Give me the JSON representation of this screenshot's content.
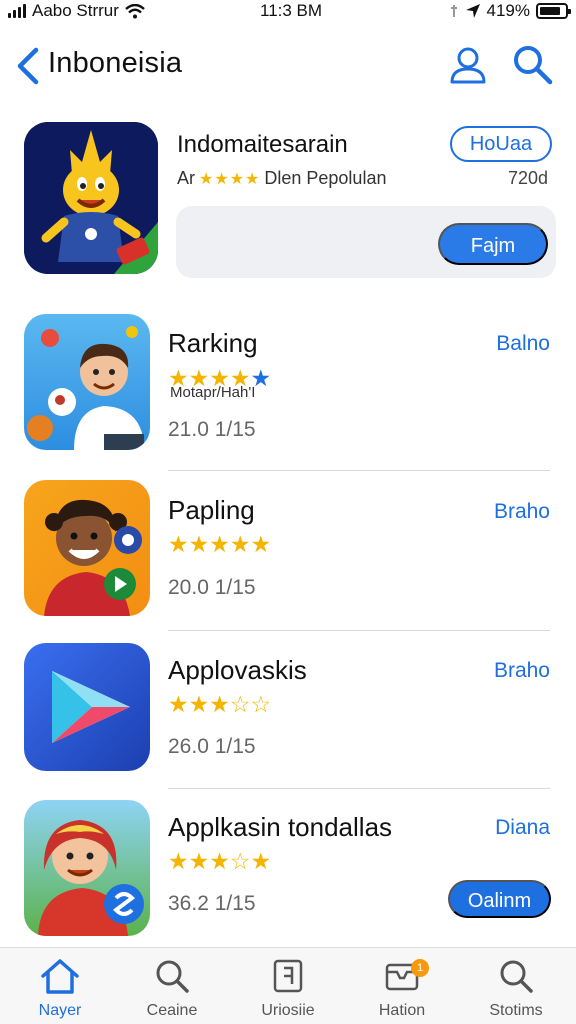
{
  "status_bar": {
    "carrier": "Aabo Strrur",
    "time": "11:3 BM",
    "battery": "419%"
  },
  "nav": {
    "title": "Inboneisia",
    "back_icon": "chevron-left-icon",
    "user_icon": "person-icon",
    "search_icon": "search-icon"
  },
  "featured": {
    "name": "Indomaitesarain",
    "sub_prefix": "Ar",
    "stars": "★★★★",
    "developer": "Dlen Pepolulan",
    "size": "720d",
    "get_label": "HoUaa",
    "panel_button": "Fajm"
  },
  "apps": [
    {
      "name": "Rarking",
      "stars": "★★★★",
      "extra_star": "★",
      "developer": "Motapr/Hah'I",
      "meta": "21.0  1/15",
      "action": "Balno"
    },
    {
      "name": "Papling",
      "stars": "★★★★★",
      "meta": "20.0  1/15",
      "action": "Braho"
    },
    {
      "name": "Applovaskis",
      "stars": "★★★",
      "empty_stars": "☆☆",
      "meta": "26.0  1/15",
      "action": "Braho"
    },
    {
      "name": "Applkasin tondallas",
      "stars": "★★★",
      "half_star": "☆",
      "last_star": "★",
      "meta": "36.2  1/15",
      "action": "Diana",
      "button": "Oalinm"
    }
  ],
  "tabs": [
    {
      "label": "Nayer",
      "icon": "home-icon",
      "active": true
    },
    {
      "label": "Ceaine",
      "icon": "search-icon"
    },
    {
      "label": "Uriosiie",
      "icon": "document-icon"
    },
    {
      "label": "Hation",
      "icon": "inbox-icon",
      "badge": "1"
    },
    {
      "label": "Stotims",
      "icon": "search-icon"
    }
  ],
  "colors": {
    "accent": "#1e6fe0",
    "star": "#f5b400",
    "badge": "#f59a0c"
  }
}
